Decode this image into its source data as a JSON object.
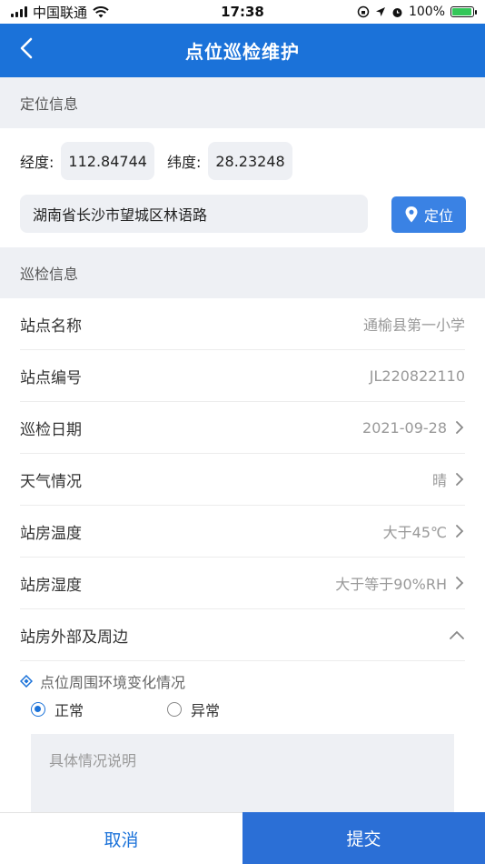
{
  "status": {
    "carrier": "中国联通",
    "time": "17:38",
    "battery": "100%",
    "battery_level": 1.0
  },
  "nav": {
    "title": "点位巡检维护"
  },
  "location_section": {
    "title": "定位信息",
    "longitude_label": "经度:",
    "longitude": "112.84744",
    "latitude_label": "纬度:",
    "latitude": "28.23248",
    "address": "湖南省长沙市望城区林语路",
    "locate_label": "定位"
  },
  "inspection_section": {
    "title": "巡检信息",
    "rows": [
      {
        "label": "站点名称",
        "value": "通榆县第一小学"
      },
      {
        "label": "站点编号",
        "value": "JL220822110"
      },
      {
        "label": "巡检日期",
        "value": "2021-09-28"
      },
      {
        "label": "天气情况",
        "value": "晴"
      },
      {
        "label": "站房温度",
        "value": "大于45℃"
      },
      {
        "label": "站房湿度",
        "value": "大于等于90%RH"
      },
      {
        "label": "站房外部及周边",
        "value": ""
      }
    ]
  },
  "surroundings": {
    "subtitle": "点位周围环境变化情况",
    "options": [
      "正常",
      "异常"
    ],
    "selected": "正常",
    "description_placeholder": "具体情况说明"
  },
  "footer": {
    "cancel_label": "取消",
    "submit_label": "提交"
  },
  "colors": {
    "primary": "#1b72d9",
    "button": "#3a82e4",
    "section_bg": "#eef0f4"
  }
}
